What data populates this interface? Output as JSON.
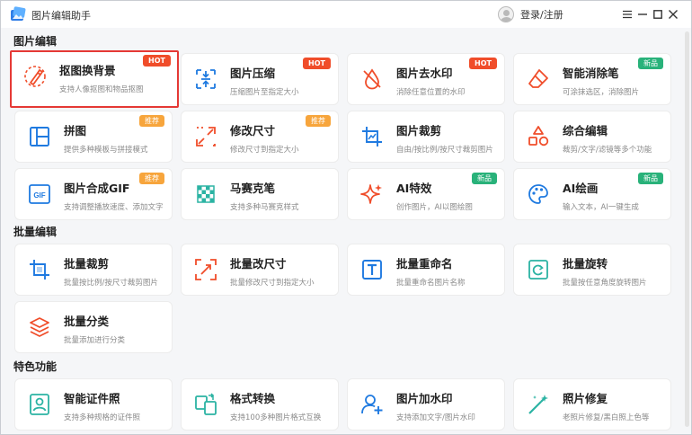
{
  "app": {
    "title": "图片编辑助手",
    "login_label": "登录/注册"
  },
  "colors": {
    "accent": "#f04d2a",
    "hot": "#f04d2a",
    "recommend": "#f7a53c",
    "new": "#29b27a",
    "blue_icon": "#1f7ae0"
  },
  "sections": [
    {
      "title": "图片编辑"
    },
    {
      "title": "批量编辑"
    },
    {
      "title": "特色功能"
    }
  ],
  "cards": [
    {
      "title": "抠图换背景",
      "desc": "支持人像抠图和物品抠图",
      "badge": "HOT",
      "icon": "cutout-brush-icon"
    },
    {
      "title": "图片压缩",
      "desc": "压缩图片至指定大小",
      "badge": "HOT",
      "icon": "compress-icon"
    },
    {
      "title": "图片去水印",
      "desc": "消除任意位置的水印",
      "badge": "HOT",
      "icon": "remove-watermark-icon"
    },
    {
      "title": "智能消除笔",
      "desc": "可涂抹选区，消除图片",
      "badge": "新品",
      "icon": "eraser-icon"
    },
    {
      "title": "拼图",
      "desc": "提供多种模板与拼接模式",
      "badge": "推荐",
      "icon": "collage-icon"
    },
    {
      "title": "修改尺寸",
      "desc": "修改尺寸到指定大小",
      "badge": "推荐",
      "icon": "resize-icon"
    },
    {
      "title": "图片裁剪",
      "desc": "自由/按比例/按尺寸裁剪图片",
      "badge": "",
      "icon": "crop-icon"
    },
    {
      "title": "综合编辑",
      "desc": "裁剪/文字/滤镜等多个功能",
      "badge": "",
      "icon": "shapes-icon"
    },
    {
      "title": "图片合成GIF",
      "desc": "支持调整播放速度、添加文字",
      "badge": "推荐",
      "icon": "gif-icon"
    },
    {
      "title": "马赛克笔",
      "desc": "支持多种马赛克样式",
      "badge": "",
      "icon": "mosaic-icon"
    },
    {
      "title": "AI特效",
      "desc": "创作图片，AI以图绘图",
      "badge": "新品",
      "icon": "sparkle-icon"
    },
    {
      "title": "AI绘画",
      "desc": "输入文本，AI一键生成",
      "badge": "新品",
      "icon": "palette-icon"
    },
    {
      "title": "批量裁剪",
      "desc": "批量按比例/按尺寸裁剪图片",
      "badge": "",
      "icon": "batch-crop-icon"
    },
    {
      "title": "批量改尺寸",
      "desc": "批量修改尺寸到指定大小",
      "badge": "",
      "icon": "batch-resize-icon"
    },
    {
      "title": "批量重命名",
      "desc": "批量重命名图片名称",
      "badge": "",
      "icon": "rename-icon"
    },
    {
      "title": "批量旋转",
      "desc": "批量按任意角度旋转图片",
      "badge": "",
      "icon": "rotate-icon"
    },
    {
      "title": "批量分类",
      "desc": "批量添加进行分类",
      "badge": "",
      "icon": "layers-icon"
    },
    {
      "title": "智能证件照",
      "desc": "支持多种规格的证件照",
      "badge": "",
      "icon": "id-photo-icon"
    },
    {
      "title": "格式转换",
      "desc": "支持100多种图片格式互换",
      "badge": "",
      "icon": "convert-icon"
    },
    {
      "title": "图片加水印",
      "desc": "支持添加文字/图片水印",
      "badge": "",
      "icon": "add-watermark-icon"
    },
    {
      "title": "照片修复",
      "desc": "老照片修复/黑白照上色等",
      "badge": "",
      "icon": "magic-wand-icon"
    }
  ]
}
